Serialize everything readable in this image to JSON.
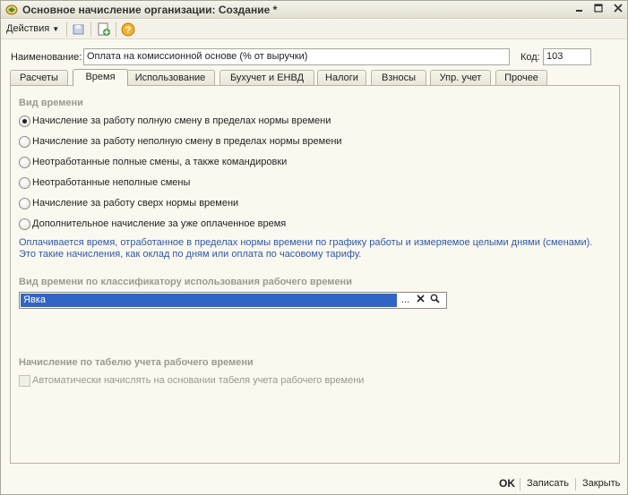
{
  "window": {
    "title": "Основное начисление организации: Создание *",
    "controls": [
      "_",
      "□",
      "×"
    ]
  },
  "toolbar": {
    "actions_label": "Действия",
    "icons": [
      "save-copy-icon",
      "new-icon",
      "help-icon"
    ]
  },
  "form": {
    "name_label": "Наименование:",
    "name_value": "Оплата на комиссионной основе (% от выручки)",
    "code_label": "Код:",
    "code_value": "103"
  },
  "tabs": [
    {
      "label": "Расчеты",
      "active": false
    },
    {
      "label": "Время",
      "active": true
    },
    {
      "label": "Использование",
      "active": false
    },
    {
      "label": "Бухучет и ЕНВД",
      "active": false
    },
    {
      "label": "Налоги",
      "active": false
    },
    {
      "label": "Взносы",
      "active": false
    },
    {
      "label": "Упр. учет",
      "active": false
    },
    {
      "label": "Прочее",
      "active": false
    }
  ],
  "time_kind": {
    "title": "Вид времени",
    "options": [
      {
        "label": "Начисление за работу полную смену в пределах нормы времени",
        "selected": true
      },
      {
        "label": "Начисление за работу неполную смену в пределах нормы времени",
        "selected": false
      },
      {
        "label": "Неотработанные полные смены, а также командировки",
        "selected": false
      },
      {
        "label": "Неотработанные неполные смены",
        "selected": false
      },
      {
        "label": "Начисление за работу сверх нормы времени",
        "selected": false
      },
      {
        "label": "Дополнительное начисление за уже оплаченное время",
        "selected": false
      }
    ],
    "info_line1": "Оплачивается время, отработанное в пределах нормы времени по графику работы и измеряемое целыми днями (сменами).",
    "info_line2": "Это такие начисления, как оклад по дням или оплата по часовому тарифу."
  },
  "classifier": {
    "title": "Вид времени по классификатору использования рабочего времени",
    "value": "Явка",
    "select_btn": "...",
    "clear_btn": "×"
  },
  "timesheet": {
    "title": "Начисление по табелю учета рабочего времени",
    "checkbox_label": "Автоматически начислять на основании табеля учета рабочего времени",
    "checked": false
  },
  "footer": {
    "ok": "OK",
    "save": "Записать",
    "close": "Закрыть"
  }
}
